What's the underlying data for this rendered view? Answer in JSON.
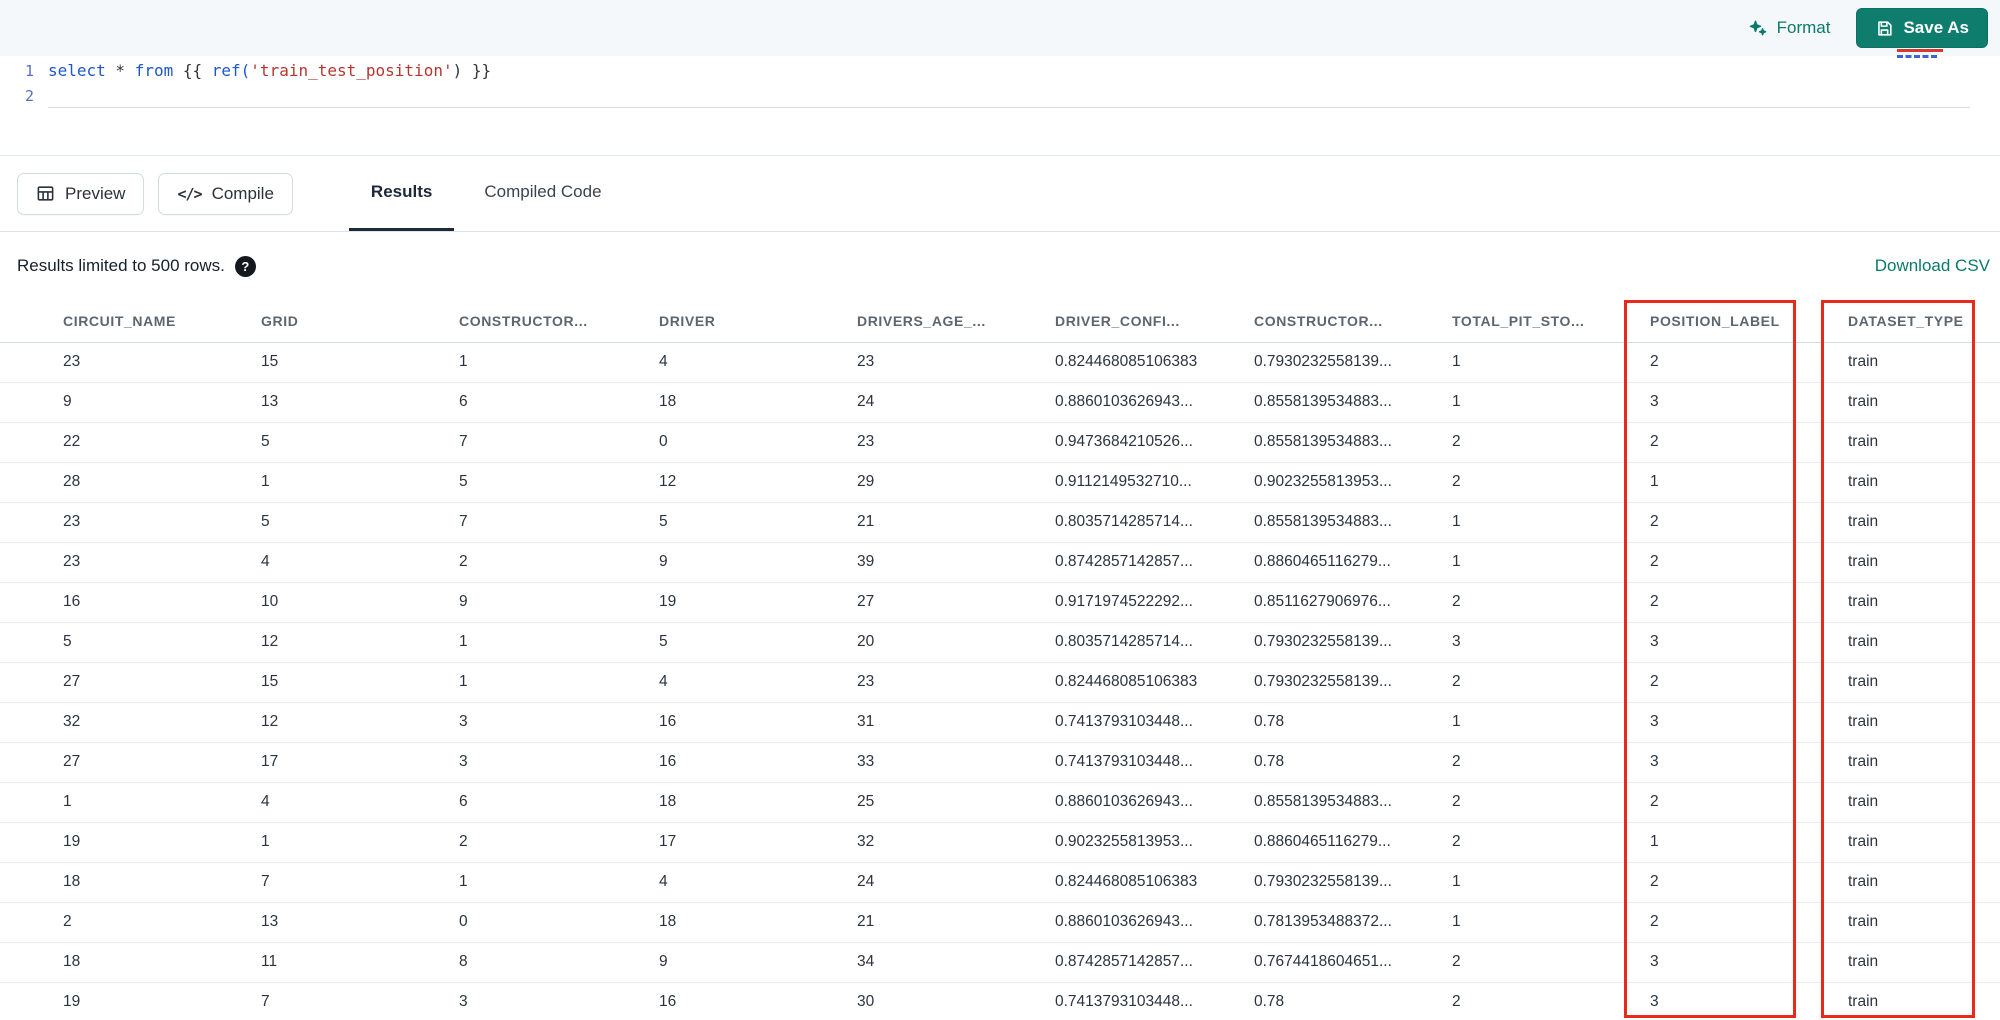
{
  "editor": {
    "toolbar": {
      "format_label": "Format",
      "save_as_label": "Save As"
    },
    "code": {
      "line_numbers": [
        "1",
        "2"
      ],
      "line1_tokens": [
        {
          "t": "select",
          "c": "keyword"
        },
        {
          "t": " * ",
          "c": "plain"
        },
        {
          "t": "from",
          "c": "keyword"
        },
        {
          "t": " {{ ",
          "c": "plain"
        },
        {
          "t": "ref(",
          "c": "keyword"
        },
        {
          "t": "'train_test_position'",
          "c": "string"
        },
        {
          "t": ") }}",
          "c": "plain"
        }
      ]
    }
  },
  "actions": {
    "preview_label": "Preview",
    "compile_label": "Compile",
    "compile_glyph": "</>"
  },
  "tabs": [
    {
      "label": "Results",
      "active": true
    },
    {
      "label": "Compiled Code",
      "active": false
    }
  ],
  "results": {
    "limit_note": "Results limited to 500 rows.",
    "help_glyph": "?",
    "download_csv_label": "Download CSV"
  },
  "table": {
    "columns": [
      "CIRCUIT_NAME",
      "GRID",
      "CONSTRUCTOR...",
      "DRIVER",
      "DRIVERS_AGE_...",
      "DRIVER_CONFI...",
      "CONSTRUCTOR...",
      "TOTAL_PIT_STO...",
      "POSITION_LABEL",
      "DATASET_TYPE"
    ],
    "rows": [
      [
        "23",
        "15",
        "1",
        "4",
        "23",
        "0.824468085106383",
        "0.7930232558139...",
        "1",
        "2",
        "train"
      ],
      [
        "9",
        "13",
        "6",
        "18",
        "24",
        "0.8860103626943...",
        "0.8558139534883...",
        "1",
        "3",
        "train"
      ],
      [
        "22",
        "5",
        "7",
        "0",
        "23",
        "0.9473684210526...",
        "0.8558139534883...",
        "2",
        "2",
        "train"
      ],
      [
        "28",
        "1",
        "5",
        "12",
        "29",
        "0.9112149532710...",
        "0.9023255813953...",
        "2",
        "1",
        "train"
      ],
      [
        "23",
        "5",
        "7",
        "5",
        "21",
        "0.8035714285714...",
        "0.8558139534883...",
        "1",
        "2",
        "train"
      ],
      [
        "23",
        "4",
        "2",
        "9",
        "39",
        "0.8742857142857...",
        "0.8860465116279...",
        "1",
        "2",
        "train"
      ],
      [
        "16",
        "10",
        "9",
        "19",
        "27",
        "0.9171974522292...",
        "0.8511627906976...",
        "2",
        "2",
        "train"
      ],
      [
        "5",
        "12",
        "1",
        "5",
        "20",
        "0.8035714285714...",
        "0.7930232558139...",
        "3",
        "3",
        "train"
      ],
      [
        "27",
        "15",
        "1",
        "4",
        "23",
        "0.824468085106383",
        "0.7930232558139...",
        "2",
        "2",
        "train"
      ],
      [
        "32",
        "12",
        "3",
        "16",
        "31",
        "0.7413793103448...",
        "0.78",
        "1",
        "3",
        "train"
      ],
      [
        "27",
        "17",
        "3",
        "16",
        "33",
        "0.7413793103448...",
        "0.78",
        "2",
        "3",
        "train"
      ],
      [
        "1",
        "4",
        "6",
        "18",
        "25",
        "0.8860103626943...",
        "0.8558139534883...",
        "2",
        "2",
        "train"
      ],
      [
        "19",
        "1",
        "2",
        "17",
        "32",
        "0.9023255813953...",
        "0.8860465116279...",
        "2",
        "1",
        "train"
      ],
      [
        "18",
        "7",
        "1",
        "4",
        "24",
        "0.824468085106383",
        "0.7930232558139...",
        "1",
        "2",
        "train"
      ],
      [
        "2",
        "13",
        "0",
        "18",
        "21",
        "0.8860103626943...",
        "0.7813953488372...",
        "1",
        "2",
        "train"
      ],
      [
        "18",
        "11",
        "8",
        "9",
        "34",
        "0.8742857142857...",
        "0.7674418604651...",
        "2",
        "3",
        "train"
      ],
      [
        "19",
        "7",
        "3",
        "16",
        "30",
        "0.7413793103448...",
        "0.78",
        "2",
        "3",
        "train"
      ]
    ]
  },
  "annotations": {
    "highlight_color": "#e8291c",
    "highlighted_columns": [
      "POSITION_LABEL",
      "DATASET_TYPE"
    ]
  }
}
